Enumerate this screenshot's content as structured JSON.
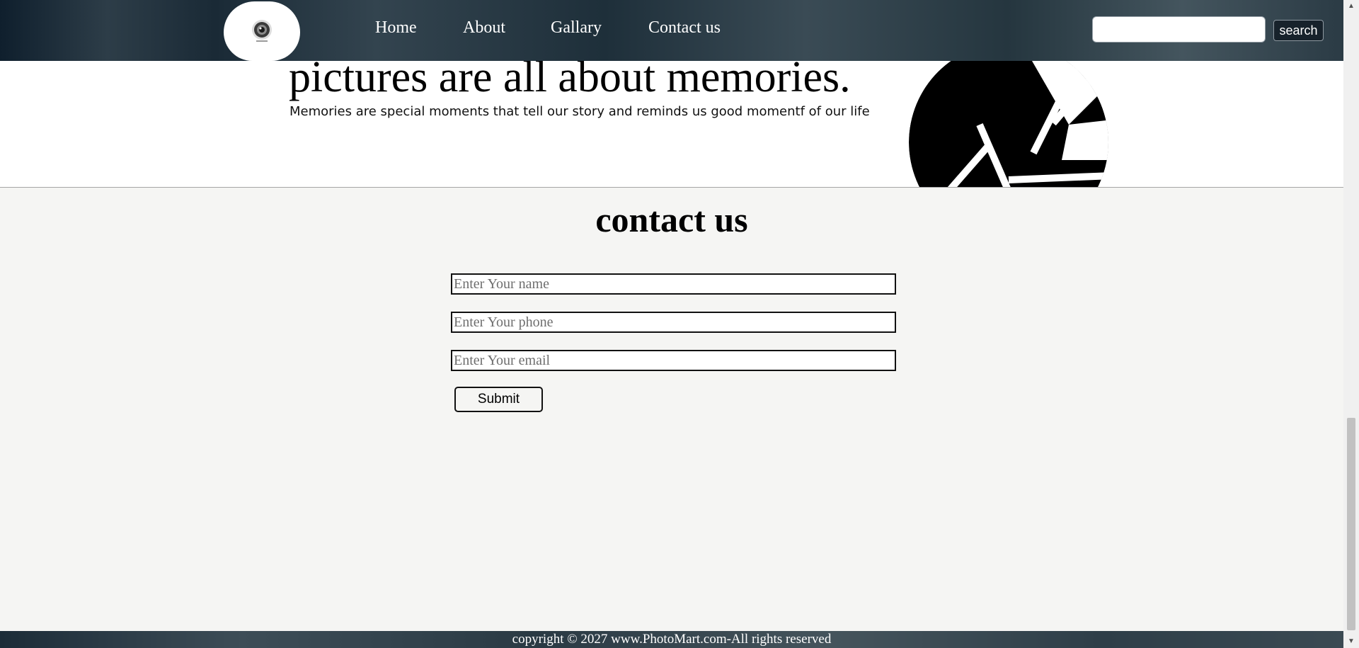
{
  "nav": {
    "links": [
      "Home",
      "About",
      "Gallary",
      "Contact us"
    ],
    "search_placeholder": "",
    "search_label": "search"
  },
  "hero": {
    "title": "pictures are all about memories.",
    "subtitle": "Memories are special moments that tell our story and reminds us good momentf of our life"
  },
  "contact": {
    "title": "contact us",
    "name_placeholder": "Enter Your name",
    "phone_placeholder": "Enter Your phone",
    "email_placeholder": "Enter Your email",
    "submit_label": "Submit"
  },
  "footer": {
    "text": "copyright © 2027 www.PhotoMart.com-All rights reserved"
  },
  "scrollbar": {
    "up_glyph": "▲",
    "down_glyph": "▼"
  },
  "colors": {
    "nav_bg": "#2d3d48",
    "contact_bg": "#f5f5f3",
    "text": "#000000"
  }
}
